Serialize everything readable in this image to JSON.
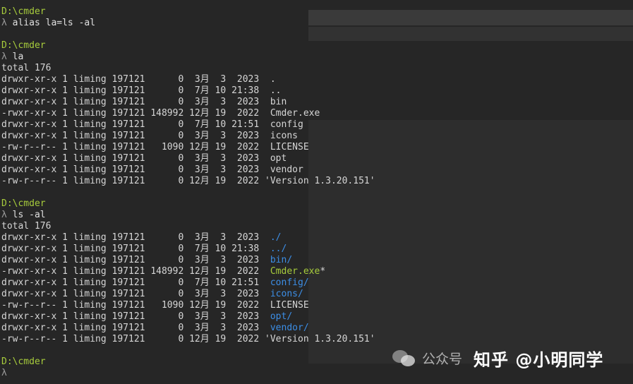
{
  "terminal": {
    "lines": [
      [
        {
          "t": "D:\\cmder",
          "c": "path"
        }
      ],
      [
        {
          "t": "λ ",
          "c": "prompt-sym"
        },
        {
          "t": "alias la=ls -al",
          "c": "cmd"
        }
      ],
      [],
      [
        {
          "t": "D:\\cmder",
          "c": "path"
        }
      ],
      [
        {
          "t": "λ ",
          "c": "prompt-sym"
        },
        {
          "t": "la",
          "c": "cmd"
        }
      ],
      [
        {
          "t": "total 176",
          "c": "plain"
        }
      ],
      [
        {
          "t": "drwxr-xr-x 1 liming 197121      0  3月  3  2023  .",
          "c": "plain"
        }
      ],
      [
        {
          "t": "drwxr-xr-x 1 liming 197121      0  7月 10 21:38  ..",
          "c": "plain"
        }
      ],
      [
        {
          "t": "drwxr-xr-x 1 liming 197121      0  3月  3  2023  bin",
          "c": "plain"
        }
      ],
      [
        {
          "t": "-rwxr-xr-x 1 liming 197121 148992 12月 19  2022  Cmder.exe",
          "c": "plain"
        }
      ],
      [
        {
          "t": "drwxr-xr-x 1 liming 197121      0  7月 10 21:51  config",
          "c": "plain"
        }
      ],
      [
        {
          "t": "drwxr-xr-x 1 liming 197121      0  3月  3  2023  icons",
          "c": "plain"
        }
      ],
      [
        {
          "t": "-rw-r--r-- 1 liming 197121   1090 12月 19  2022  LICENSE",
          "c": "plain"
        }
      ],
      [
        {
          "t": "drwxr-xr-x 1 liming 197121      0  3月  3  2023  opt",
          "c": "plain"
        }
      ],
      [
        {
          "t": "drwxr-xr-x 1 liming 197121      0  3月  3  2023  vendor",
          "c": "plain"
        }
      ],
      [
        {
          "t": "-rw-r--r-- 1 liming 197121      0 12月 19  2022 'Version 1.3.20.151'",
          "c": "plain"
        }
      ],
      [],
      [
        {
          "t": "D:\\cmder",
          "c": "path"
        }
      ],
      [
        {
          "t": "λ ",
          "c": "prompt-sym"
        },
        {
          "t": "ls -al",
          "c": "cmd"
        }
      ],
      [
        {
          "t": "total 176",
          "c": "plain"
        }
      ],
      [
        {
          "t": "drwxr-xr-x 1 liming 197121      0  3月  3  2023  ",
          "c": "plain"
        },
        {
          "t": "./",
          "c": "dir-blue"
        }
      ],
      [
        {
          "t": "drwxr-xr-x 1 liming 197121      0  7月 10 21:38  ",
          "c": "plain"
        },
        {
          "t": "../",
          "c": "dir-blue"
        }
      ],
      [
        {
          "t": "drwxr-xr-x 1 liming 197121      0  3月  3  2023  ",
          "c": "plain"
        },
        {
          "t": "bin/",
          "c": "dir-blue"
        }
      ],
      [
        {
          "t": "-rwxr-xr-x 1 liming 197121 148992 12月 19  2022  ",
          "c": "plain"
        },
        {
          "t": "Cmder.exe",
          "c": "exe-green"
        },
        {
          "t": "*",
          "c": "plain"
        }
      ],
      [
        {
          "t": "drwxr-xr-x 1 liming 197121      0  7月 10 21:51  ",
          "c": "plain"
        },
        {
          "t": "config/",
          "c": "dir-blue"
        }
      ],
      [
        {
          "t": "drwxr-xr-x 1 liming 197121      0  3月  3  2023  ",
          "c": "plain"
        },
        {
          "t": "icons/",
          "c": "dir-blue"
        }
      ],
      [
        {
          "t": "-rw-r--r-- 1 liming 197121   1090 12月 19  2022  LICENSE",
          "c": "plain"
        }
      ],
      [
        {
          "t": "drwxr-xr-x 1 liming 197121      0  3月  3  2023  ",
          "c": "plain"
        },
        {
          "t": "opt/",
          "c": "dir-blue"
        }
      ],
      [
        {
          "t": "drwxr-xr-x 1 liming 197121      0  3月  3  2023  ",
          "c": "plain"
        },
        {
          "t": "vendor/",
          "c": "dir-blue"
        }
      ],
      [
        {
          "t": "-rw-r--r-- 1 liming 197121      0 12月 19  2022 'Version 1.3.20.151'",
          "c": "plain"
        }
      ],
      [],
      [
        {
          "t": "D:\\cmder",
          "c": "path"
        }
      ],
      [
        {
          "t": "λ",
          "c": "prompt-sym"
        }
      ]
    ]
  },
  "watermark": {
    "account": "公众号",
    "author": "知乎 @小明同学"
  },
  "colors": {
    "background": "#262626",
    "path_green": "#a7cc3c",
    "directory_blue": "#3c8ee6",
    "text": "#d6d6d6"
  }
}
